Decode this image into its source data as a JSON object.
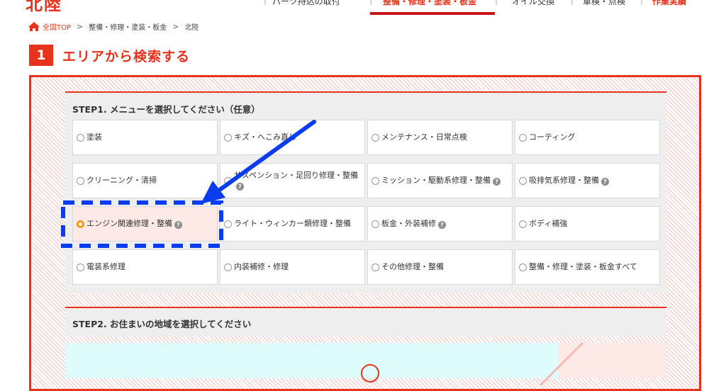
{
  "header": {
    "brand": "北陸",
    "nav": [
      {
        "label": "パーツ持込の取付"
      },
      {
        "label": "整備・修理・塗装・板金",
        "active": true
      },
      {
        "label": "オイル交換"
      },
      {
        "label": "車検・点検"
      },
      {
        "label": "作業実績"
      }
    ]
  },
  "breadcrumb": {
    "home_icon": "home-icon",
    "items": [
      "全国TOP",
      "整備・修理・塗装・板金",
      "北陸"
    ]
  },
  "section": {
    "number": "1",
    "title": "エリアから検索する"
  },
  "step1": {
    "title": "STEP1. メニューを選択してください（任意）",
    "options": [
      {
        "label": "塗装",
        "help": false
      },
      {
        "label": "キズ・へこみ直し",
        "help": false
      },
      {
        "label": "メンテナンス・日常点検",
        "help": false
      },
      {
        "label": "コーティング",
        "help": false
      },
      {
        "label": "クリーニング・清掃",
        "help": false
      },
      {
        "label": "サスペンション・足回り修理・整備",
        "help": true
      },
      {
        "label": "ミッション・駆動系修理・整備",
        "help": true
      },
      {
        "label": "吸排気系修理・整備",
        "help": true
      },
      {
        "label": "エンジン関連修理・整備",
        "help": true,
        "selected": true
      },
      {
        "label": "ライト・ウィンカー類修理・整備",
        "help": false
      },
      {
        "label": "板金・外装補修",
        "help": true
      },
      {
        "label": "ボディ補強",
        "help": false
      },
      {
        "label": "電装系修理",
        "help": false
      },
      {
        "label": "内装補修・修理",
        "help": false
      },
      {
        "label": "その他修理・整備",
        "help": false
      },
      {
        "label": "整備・修理・塗装・板金すべて",
        "help": false
      }
    ]
  },
  "step2": {
    "title": "STEP2. お住まいの地域を選択してください"
  },
  "help_mark": "?",
  "colors": {
    "accent": "#e8331c",
    "radio_selected": "#f39a1b",
    "annotation": "#0a3cf0"
  }
}
